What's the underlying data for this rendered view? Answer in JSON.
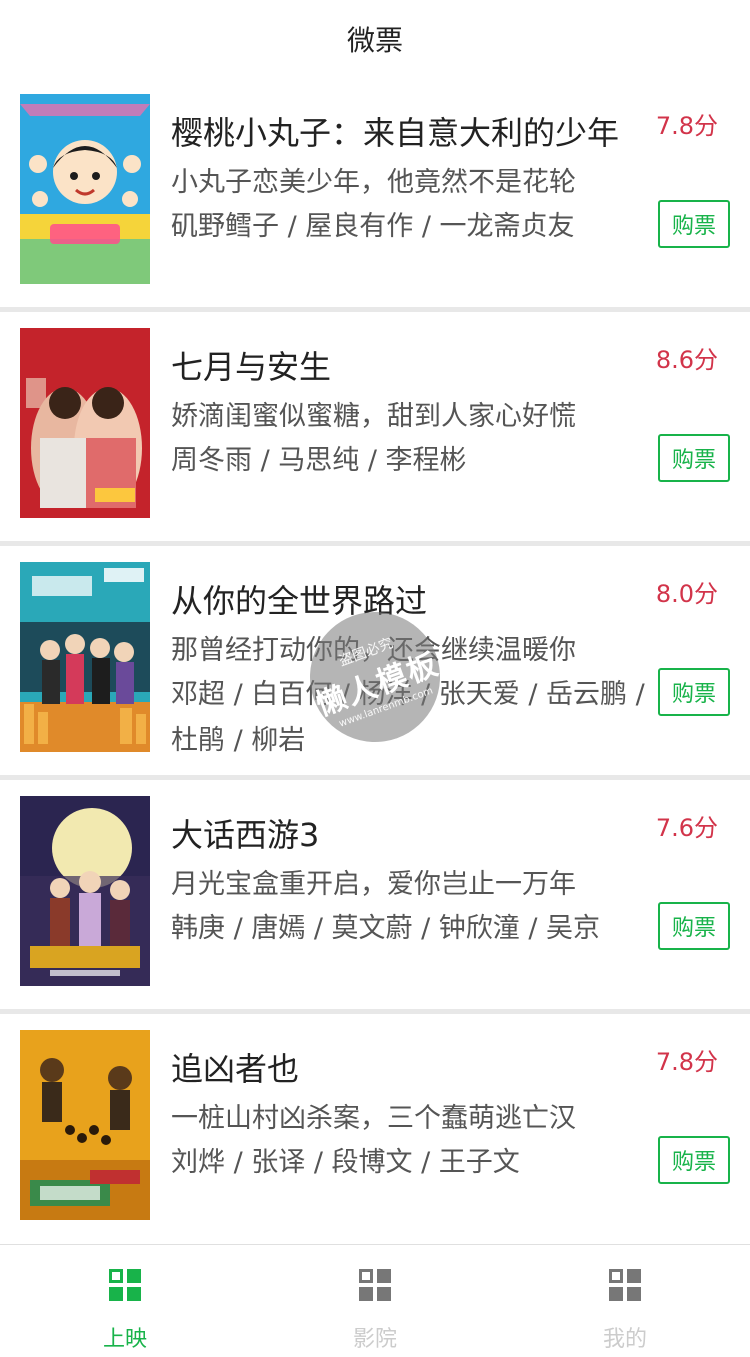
{
  "header": {
    "title": "微票"
  },
  "movies": [
    {
      "title": "樱桃小丸子：来自意大利的少年",
      "desc": "小丸子恋美少年，他竟然不是花轮",
      "cast": "矶野鳕子 / 屋良有作 / 一龙斋贞友",
      "score": "7.8分",
      "buy": "购票",
      "poster_colors": [
        "#2fa8e0",
        "#f5d43a"
      ]
    },
    {
      "title": "七月与安生",
      "desc": "娇滴闺蜜似蜜糖，甜到人家心好慌",
      "cast": "周冬雨 / 马思纯 / 李程彬",
      "score": "8.6分",
      "buy": "购票",
      "poster_colors": [
        "#c4232b",
        "#e8b7a0"
      ]
    },
    {
      "title": "从你的全世界路过",
      "desc": "那曾经打动你的，还会继续温暖你",
      "cast": "邓超 / 白百何 / 杨洋 / 张天爱 / 岳云鹏 / 杜鹃 / 柳岩",
      "score": "8.0分",
      "buy": "购票",
      "poster_colors": [
        "#2aa8b8",
        "#e08a2a"
      ]
    },
    {
      "title": "大话西游3",
      "desc": "月光宝盒重开启，爱你岂止一万年",
      "cast": "韩庚 / 唐嫣 / 莫文蔚 / 钟欣潼 / 吴京",
      "score": "7.6分",
      "buy": "购票",
      "poster_colors": [
        "#2b2550",
        "#f2e9b0"
      ]
    },
    {
      "title": "追凶者也",
      "desc": "一桩山村凶杀案，三个蠢萌逃亡汉",
      "cast": "刘烨 / 张译 / 段博文 / 王子文",
      "score": "7.8分",
      "buy": "购票",
      "poster_colors": [
        "#e8a21c",
        "#5a3a1a"
      ]
    }
  ],
  "tabs": [
    {
      "label": "上映",
      "active": true,
      "color": "#18b34a"
    },
    {
      "label": "影院",
      "active": false,
      "color": "#cccccc"
    },
    {
      "label": "我的",
      "active": false,
      "color": "#cccccc"
    }
  ],
  "watermark": {
    "top": "盗图必究",
    "mid": "懒人模板",
    "bottom": "www.lanrenmb.com"
  },
  "colors": {
    "accent": "#18b34a",
    "score": "#d2344a"
  }
}
